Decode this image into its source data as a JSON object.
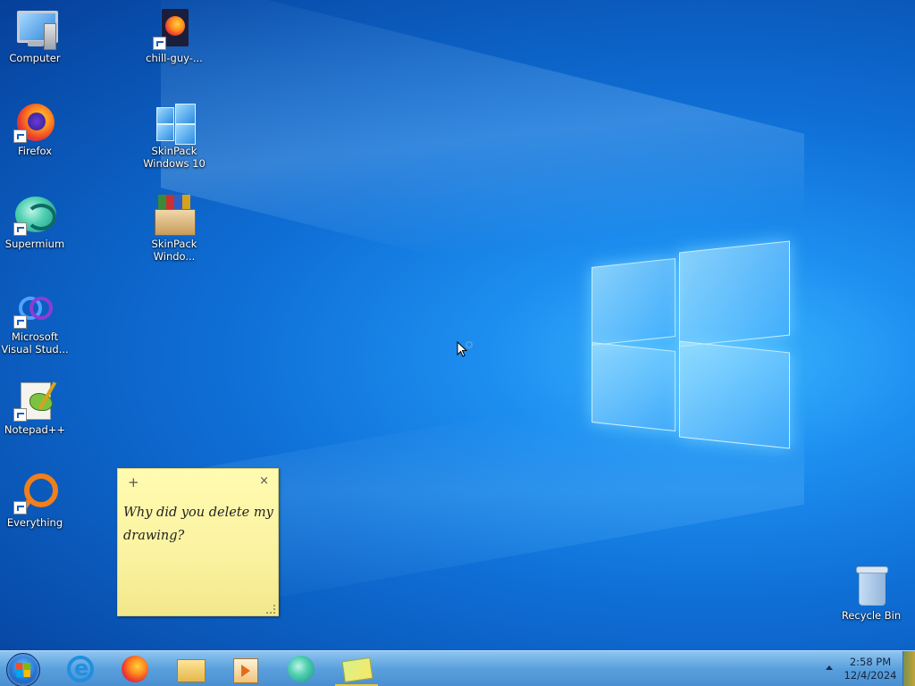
{
  "desktop": {
    "icons": [
      {
        "label": "Computer",
        "icon": "computer-icon"
      },
      {
        "label": "Firefox",
        "icon": "firefox-icon"
      },
      {
        "label": "Supermium",
        "icon": "supermium-icon"
      },
      {
        "label": "Microsoft Visual Stud...",
        "icon": "visual-studio-icon"
      },
      {
        "label": "Notepad++",
        "icon": "notepad-plus-plus-icon"
      },
      {
        "label": "Everything",
        "icon": "everything-icon"
      },
      {
        "label": "chill-guy-...",
        "icon": "firefox-document-icon"
      },
      {
        "label": "SkinPack Windows 10",
        "icon": "windows-logo-icon"
      },
      {
        "label": "SkinPack Windo...",
        "icon": "package-icon"
      },
      {
        "label": "Recycle Bin",
        "icon": "recycle-bin-icon"
      }
    ]
  },
  "sticky_note": {
    "add_symbol": "+",
    "close_symbol": "×",
    "text": "Why did you delete my drawing?"
  },
  "taskbar": {
    "apps": [
      {
        "name": "internet-explorer",
        "icon": "internet-explorer-icon"
      },
      {
        "name": "firefox",
        "icon": "firefox-icon"
      },
      {
        "name": "file-explorer",
        "icon": "folder-icon"
      },
      {
        "name": "media-player",
        "icon": "media-player-icon"
      },
      {
        "name": "supermium",
        "icon": "supermium-icon"
      },
      {
        "name": "sticky-notes",
        "icon": "sticky-notes-icon"
      }
    ],
    "clock": {
      "time": "2:58 PM",
      "date": "12/4/2024"
    }
  },
  "colors": {
    "wallpaper_accent": "#1d8ff0",
    "taskbar": "#5aa0dd",
    "sticky_note": "#fbf2a0"
  }
}
